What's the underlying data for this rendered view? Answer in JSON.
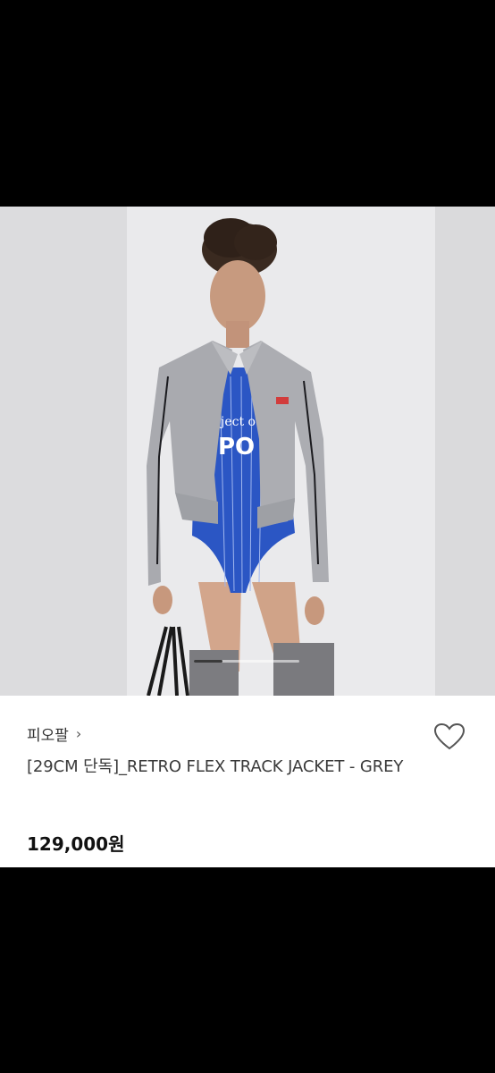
{
  "product": {
    "brand": "피오팔",
    "brand_chevron": "›",
    "title": "[29CM 단독]_RETRO FLEX TRACK JACKET - GREY",
    "price": "129,000원",
    "favorite_icon": "heart-outline-icon"
  },
  "image": {
    "bodysuit_print_top": "ject o",
    "bodysuit_print_bottom": "PO"
  },
  "carousel": {
    "current_fraction": 0.27
  },
  "colors": {
    "background": "#000000",
    "card": "#ffffff",
    "price": "#111111",
    "jacket": "#a9aaaf",
    "bodysuit": "#2b56c4"
  }
}
